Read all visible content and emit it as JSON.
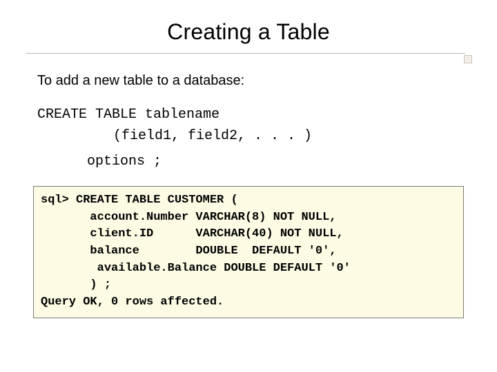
{
  "title": "Creating a Table",
  "intro": "To add a new table to a database:",
  "syntax": {
    "line1": "CREATE TABLE tablename",
    "line2": "(field1, field2, . . . )",
    "line3": "options ;"
  },
  "codebox": "sql> CREATE TABLE CUSTOMER (\n       account.Number VARCHAR(8) NOT NULL,\n       client.ID      VARCHAR(40) NOT NULL,\n       balance        DOUBLE  DEFAULT '0',\n        available.Balance DOUBLE DEFAULT '0'\n       ) ;\nQuery OK, 0 rows affected."
}
